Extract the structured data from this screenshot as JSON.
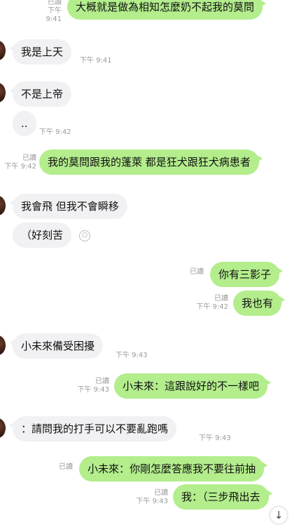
{
  "messages": [
    {
      "text": "大概就是做為相知怎麼奶不起我的莫問",
      "read": "已讀",
      "time": "下午 9:41"
    },
    {
      "text": "我是上天",
      "time": "下午 9:41"
    },
    {
      "text": "不是上帝"
    },
    {
      "text": "..",
      "time": "下午 9:42"
    },
    {
      "text": "我的莫問跟我的蓬萊 都是狂犬跟狂犬病患者",
      "read": "已讀",
      "time": "下午 9:42"
    },
    {
      "text": "我會飛 但我不會瞬移"
    },
    {
      "text": "（好刻苦"
    },
    {
      "text": "你有三影子",
      "read": "已讀"
    },
    {
      "text": "我也有",
      "read": "已讀",
      "time": "下午 9:42"
    },
    {
      "text": "小未來備受困擾",
      "time": "下午 9:43"
    },
    {
      "text": "小未來：這跟說好的不一樣吧",
      "read": "已讀",
      "time": "下午 9:43"
    },
    {
      "text": "：請問我的打手可以不要亂跑嗎",
      "time": "下午 9:43"
    },
    {
      "text": "小未來：你剛怎麼答應我不要往前抽",
      "read": "已讀"
    },
    {
      "text": "我：（三步飛出去",
      "read": "已讀",
      "time": "下午 9:43"
    }
  ],
  "scroll_down_icon": "↓",
  "colors": {
    "outgoing": "#b3ed8c",
    "incoming": "#f1f1f3",
    "meta": "#9a9a9a"
  }
}
